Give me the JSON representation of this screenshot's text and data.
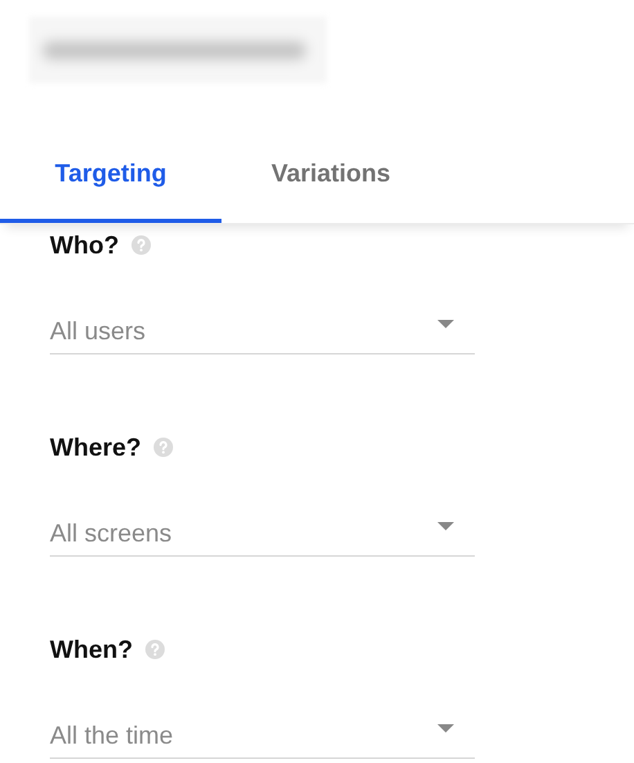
{
  "header": {
    "title_blurred": true
  },
  "tabs": [
    {
      "label": "Targeting",
      "selected": true
    },
    {
      "label": "Variations",
      "selected": false
    }
  ],
  "sections": [
    {
      "question": "Who?",
      "value": "All users"
    },
    {
      "question": "Where?",
      "value": "All screens"
    },
    {
      "question": "When?",
      "value": "All the time"
    }
  ]
}
